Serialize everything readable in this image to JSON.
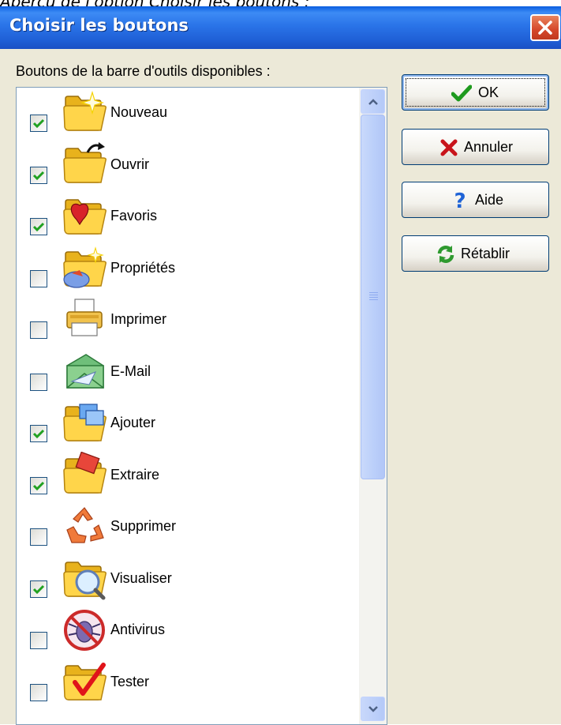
{
  "caption": "Aperçu de l'option Choisir les boutons :",
  "window": {
    "title": "Choisir les boutons"
  },
  "list": {
    "label": "Boutons de la barre d'outils disponibles :",
    "items": [
      {
        "label": "Nouveau",
        "checked": true,
        "icon": "new-folder-sparkle-icon"
      },
      {
        "label": "Ouvrir",
        "checked": true,
        "icon": "open-folder-icon"
      },
      {
        "label": "Favoris",
        "checked": true,
        "icon": "favorites-heart-folder-icon"
      },
      {
        "label": "Propriétés",
        "checked": false,
        "icon": "properties-folder-icon"
      },
      {
        "label": "Imprimer",
        "checked": false,
        "icon": "printer-icon"
      },
      {
        "label": "E-Mail",
        "checked": false,
        "icon": "email-envelope-icon"
      },
      {
        "label": "Ajouter",
        "checked": true,
        "icon": "add-folder-icon"
      },
      {
        "label": "Extraire",
        "checked": true,
        "icon": "extract-folder-icon"
      },
      {
        "label": "Supprimer",
        "checked": false,
        "icon": "recycle-icon"
      },
      {
        "label": "Visualiser",
        "checked": true,
        "icon": "view-magnifier-icon"
      },
      {
        "label": "Antivirus",
        "checked": false,
        "icon": "antivirus-bug-icon"
      },
      {
        "label": "Tester",
        "checked": false,
        "icon": "test-checkmark-folder-icon"
      }
    ]
  },
  "buttons": {
    "ok": "OK",
    "cancel": "Annuler",
    "help": "Aide",
    "reset": "Rétablir"
  },
  "colors": {
    "titlebar": "#0a5ee0",
    "dialog_bg": "#ece9d8",
    "checkmark": "#21a121",
    "close_button": "#d5472a"
  }
}
